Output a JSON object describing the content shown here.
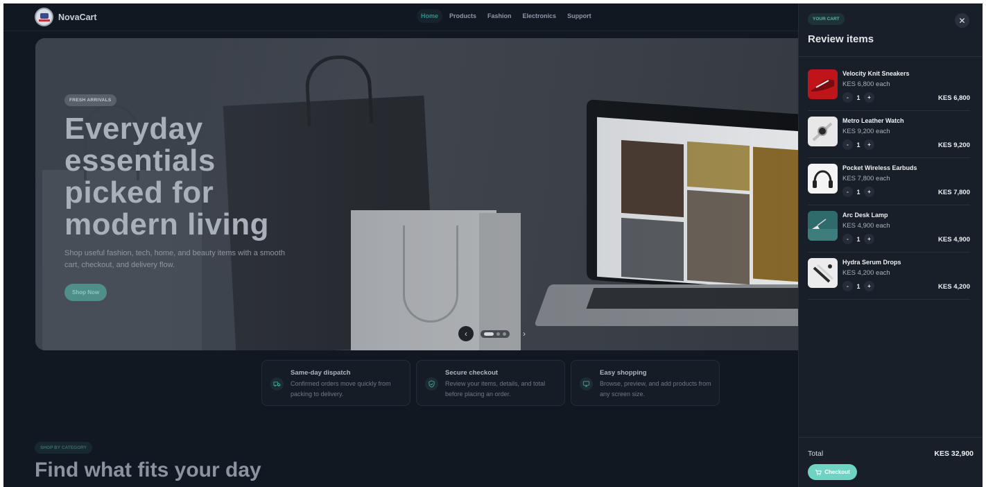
{
  "brand": {
    "name": "NovaCart"
  },
  "nav": {
    "items": [
      {
        "label": "Home",
        "active": true
      },
      {
        "label": "Products",
        "active": false
      },
      {
        "label": "Fashion",
        "active": false
      },
      {
        "label": "Electronics",
        "active": false
      },
      {
        "label": "Support",
        "active": false
      }
    ]
  },
  "hero": {
    "badge": "FRESH ARRIVALS",
    "title": "Everyday essentials picked for modern living",
    "subtitle": "Shop useful fashion, tech, home, and beauty items with a smooth cart, checkout, and delivery flow.",
    "cta": "Shop Now",
    "carousel": {
      "prev_icon": "chevron-left-icon",
      "next_icon": "chevron-right-icon",
      "slides": 3,
      "active_slide": 1
    }
  },
  "features": [
    {
      "icon": "truck-icon",
      "title": "Same-day dispatch",
      "desc": "Confirmed orders move quickly from packing to delivery."
    },
    {
      "icon": "shield-check-icon",
      "title": "Secure checkout",
      "desc": "Review your items, details, and total before placing an order."
    },
    {
      "icon": "monitor-icon",
      "title": "Easy shopping",
      "desc": "Browse, preview, and add products from any screen size."
    }
  ],
  "categories": {
    "badge": "SHOP BY CATEGORY",
    "title": "Find what fits your day"
  },
  "cart": {
    "badge": "YOUR CART",
    "title": "Review items",
    "close_icon": "close-icon",
    "items": [
      {
        "name": "Velocity Knit Sneakers",
        "price": "KES 6,800 each",
        "qty": "1",
        "total": "KES 6,800",
        "thumb": "sneaker-image"
      },
      {
        "name": "Metro Leather Watch",
        "price": "KES 9,200 each",
        "qty": "1",
        "total": "KES 9,200",
        "thumb": "watch-image"
      },
      {
        "name": "Pocket Wireless Earbuds",
        "price": "KES 7,800 each",
        "qty": "1",
        "total": "KES 7,800",
        "thumb": "headphones-image"
      },
      {
        "name": "Arc Desk Lamp",
        "price": "KES 4,900 each",
        "qty": "1",
        "total": "KES 4,900",
        "thumb": "lamp-image"
      },
      {
        "name": "Hydra Serum Drops",
        "price": "KES 4,200 each",
        "qty": "1",
        "total": "KES 4,200",
        "thumb": "serum-image"
      }
    ],
    "qty_minus": "-",
    "qty_plus": "+",
    "total_label": "Total",
    "total_value": "KES 32,900",
    "checkout_label": "Checkout",
    "checkout_icon": "cart-icon"
  },
  "colors": {
    "page_bg": "#121821",
    "drawer_bg": "#191f28",
    "accent": "#6fd3c3",
    "nav_active": "#2f8f86"
  }
}
